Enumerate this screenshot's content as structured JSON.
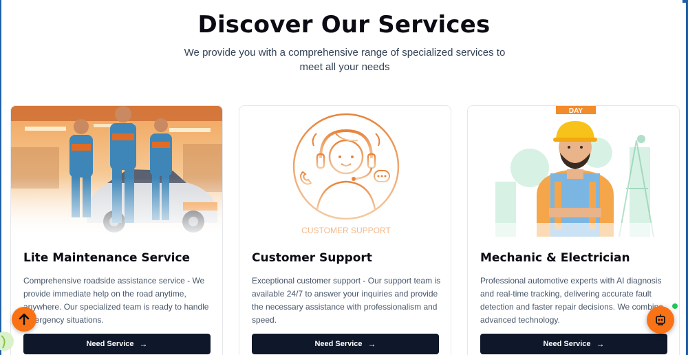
{
  "section": {
    "title": "Discover Our Services",
    "subtitle": "We provide you with a comprehensive range of specialized services to meet all your needs"
  },
  "cards": [
    {
      "title": "Lite Maintenance Service",
      "description": "Comprehensive roadside assistance service - We provide immediate help on the road anytime, anywhere. Our specialized team is ready to handle emergency situations.",
      "button_label": "Need Service",
      "image": "mechanics-team-with-car"
    },
    {
      "title": "Customer Support",
      "description": "Exceptional customer support - Our support team is available 24/7 to answer your inquiries and provide the necessary assistance with professionalism and speed.",
      "button_label": "Need Service",
      "image": "customer-support-headset",
      "image_caption": "CUSTOMER SUPPORT"
    },
    {
      "title": "Mechanic & Electrician",
      "description": "Professional automotive experts with AI diagnosis and real-time tracking, delivering accurate fault detection and faster repair decisions. We combine advanced technology.",
      "button_label": "Need Service",
      "image": "mechanic-with-hard-hat",
      "image_banner": "DAY"
    }
  ],
  "floating": {
    "scroll_top_icon": "arrow-up-icon",
    "chat_icon": "robot-icon"
  },
  "colors": {
    "accent": "#f97316",
    "button_bg": "#0f172a",
    "frame": "#1e5fa8",
    "online": "#22c55e"
  }
}
